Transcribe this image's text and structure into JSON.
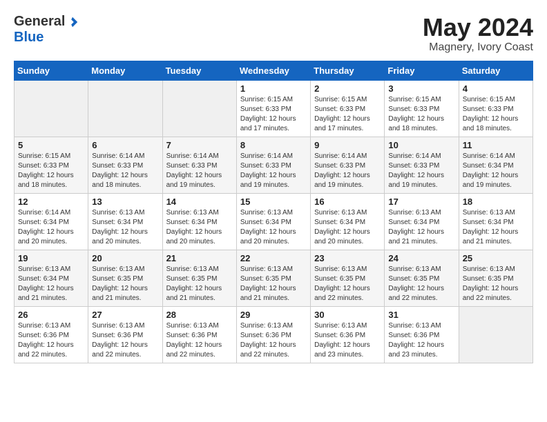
{
  "header": {
    "logo_general": "General",
    "logo_blue": "Blue",
    "month_year": "May 2024",
    "location": "Magnery, Ivory Coast"
  },
  "weekdays": [
    "Sunday",
    "Monday",
    "Tuesday",
    "Wednesday",
    "Thursday",
    "Friday",
    "Saturday"
  ],
  "weeks": [
    [
      {
        "day": "",
        "info": ""
      },
      {
        "day": "",
        "info": ""
      },
      {
        "day": "",
        "info": ""
      },
      {
        "day": "1",
        "info": "Sunrise: 6:15 AM\nSunset: 6:33 PM\nDaylight: 12 hours\nand 17 minutes."
      },
      {
        "day": "2",
        "info": "Sunrise: 6:15 AM\nSunset: 6:33 PM\nDaylight: 12 hours\nand 17 minutes."
      },
      {
        "day": "3",
        "info": "Sunrise: 6:15 AM\nSunset: 6:33 PM\nDaylight: 12 hours\nand 18 minutes."
      },
      {
        "day": "4",
        "info": "Sunrise: 6:15 AM\nSunset: 6:33 PM\nDaylight: 12 hours\nand 18 minutes."
      }
    ],
    [
      {
        "day": "5",
        "info": "Sunrise: 6:15 AM\nSunset: 6:33 PM\nDaylight: 12 hours\nand 18 minutes."
      },
      {
        "day": "6",
        "info": "Sunrise: 6:14 AM\nSunset: 6:33 PM\nDaylight: 12 hours\nand 18 minutes."
      },
      {
        "day": "7",
        "info": "Sunrise: 6:14 AM\nSunset: 6:33 PM\nDaylight: 12 hours\nand 19 minutes."
      },
      {
        "day": "8",
        "info": "Sunrise: 6:14 AM\nSunset: 6:33 PM\nDaylight: 12 hours\nand 19 minutes."
      },
      {
        "day": "9",
        "info": "Sunrise: 6:14 AM\nSunset: 6:33 PM\nDaylight: 12 hours\nand 19 minutes."
      },
      {
        "day": "10",
        "info": "Sunrise: 6:14 AM\nSunset: 6:33 PM\nDaylight: 12 hours\nand 19 minutes."
      },
      {
        "day": "11",
        "info": "Sunrise: 6:14 AM\nSunset: 6:34 PM\nDaylight: 12 hours\nand 19 minutes."
      }
    ],
    [
      {
        "day": "12",
        "info": "Sunrise: 6:14 AM\nSunset: 6:34 PM\nDaylight: 12 hours\nand 20 minutes."
      },
      {
        "day": "13",
        "info": "Sunrise: 6:13 AM\nSunset: 6:34 PM\nDaylight: 12 hours\nand 20 minutes."
      },
      {
        "day": "14",
        "info": "Sunrise: 6:13 AM\nSunset: 6:34 PM\nDaylight: 12 hours\nand 20 minutes."
      },
      {
        "day": "15",
        "info": "Sunrise: 6:13 AM\nSunset: 6:34 PM\nDaylight: 12 hours\nand 20 minutes."
      },
      {
        "day": "16",
        "info": "Sunrise: 6:13 AM\nSunset: 6:34 PM\nDaylight: 12 hours\nand 20 minutes."
      },
      {
        "day": "17",
        "info": "Sunrise: 6:13 AM\nSunset: 6:34 PM\nDaylight: 12 hours\nand 21 minutes."
      },
      {
        "day": "18",
        "info": "Sunrise: 6:13 AM\nSunset: 6:34 PM\nDaylight: 12 hours\nand 21 minutes."
      }
    ],
    [
      {
        "day": "19",
        "info": "Sunrise: 6:13 AM\nSunset: 6:34 PM\nDaylight: 12 hours\nand 21 minutes."
      },
      {
        "day": "20",
        "info": "Sunrise: 6:13 AM\nSunset: 6:35 PM\nDaylight: 12 hours\nand 21 minutes."
      },
      {
        "day": "21",
        "info": "Sunrise: 6:13 AM\nSunset: 6:35 PM\nDaylight: 12 hours\nand 21 minutes."
      },
      {
        "day": "22",
        "info": "Sunrise: 6:13 AM\nSunset: 6:35 PM\nDaylight: 12 hours\nand 21 minutes."
      },
      {
        "day": "23",
        "info": "Sunrise: 6:13 AM\nSunset: 6:35 PM\nDaylight: 12 hours\nand 22 minutes."
      },
      {
        "day": "24",
        "info": "Sunrise: 6:13 AM\nSunset: 6:35 PM\nDaylight: 12 hours\nand 22 minutes."
      },
      {
        "day": "25",
        "info": "Sunrise: 6:13 AM\nSunset: 6:35 PM\nDaylight: 12 hours\nand 22 minutes."
      }
    ],
    [
      {
        "day": "26",
        "info": "Sunrise: 6:13 AM\nSunset: 6:36 PM\nDaylight: 12 hours\nand 22 minutes."
      },
      {
        "day": "27",
        "info": "Sunrise: 6:13 AM\nSunset: 6:36 PM\nDaylight: 12 hours\nand 22 minutes."
      },
      {
        "day": "28",
        "info": "Sunrise: 6:13 AM\nSunset: 6:36 PM\nDaylight: 12 hours\nand 22 minutes."
      },
      {
        "day": "29",
        "info": "Sunrise: 6:13 AM\nSunset: 6:36 PM\nDaylight: 12 hours\nand 22 minutes."
      },
      {
        "day": "30",
        "info": "Sunrise: 6:13 AM\nSunset: 6:36 PM\nDaylight: 12 hours\nand 23 minutes."
      },
      {
        "day": "31",
        "info": "Sunrise: 6:13 AM\nSunset: 6:36 PM\nDaylight: 12 hours\nand 23 minutes."
      },
      {
        "day": "",
        "info": ""
      }
    ]
  ]
}
